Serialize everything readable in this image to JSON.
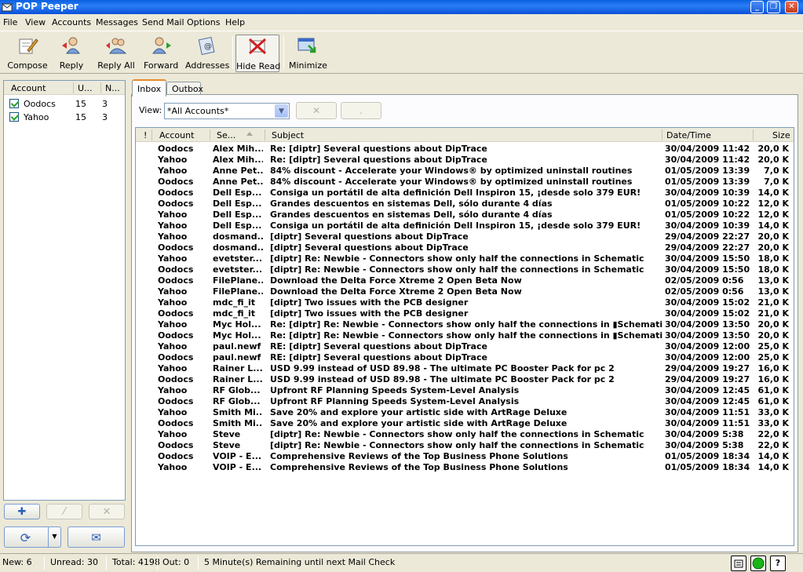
{
  "window": {
    "title": "POP Peeper"
  },
  "menu": [
    "File",
    "View",
    "Accounts",
    "Messages",
    "Send Mail",
    "Options",
    "Help"
  ],
  "toolbar": {
    "compose": "Compose",
    "reply": "Reply",
    "reply_all": "Reply All",
    "forward": "Forward",
    "addresses": "Addresses",
    "hide_read": "Hide Read",
    "minimize": "Minimize"
  },
  "accounts_panel": {
    "headers": {
      "account": "Account",
      "unread": "U...",
      "new": "N..."
    },
    "rows": [
      {
        "name": "Oodocs",
        "unread": "15",
        "new": "3"
      },
      {
        "name": "Yahoo",
        "unread": "15",
        "new": "3"
      }
    ]
  },
  "tabs": {
    "inbox": "Inbox",
    "outbox": "Outbox"
  },
  "view": {
    "label": "View:",
    "selected": "*All Accounts*"
  },
  "message_list": {
    "headers": {
      "flag": "!",
      "account": "Account",
      "sender": "Se...",
      "subject": "Subject",
      "date": "Date/Time",
      "size": "Size"
    },
    "rows": [
      {
        "account": "Oodocs",
        "sender": "Alex Mih...",
        "subject": "Re: [diptr] Several questions about DipTrace",
        "date": "30/04/2009 11:42",
        "size": "20,0 K"
      },
      {
        "account": "Yahoo",
        "sender": "Alex Mih...",
        "subject": "Re: [diptr] Several questions about DipTrace",
        "date": "30/04/2009 11:42",
        "size": "20,0 K"
      },
      {
        "account": "Yahoo",
        "sender": "Anne Pet...",
        "subject": "84% discount - Accelerate your Windows® by optimized uninstall routines",
        "date": "01/05/2009 13:39",
        "size": "7,0 K"
      },
      {
        "account": "Oodocs",
        "sender": "Anne Pet...",
        "subject": "84% discount - Accelerate your Windows® by optimized uninstall routines",
        "date": "01/05/2009 13:39",
        "size": "7,0 K"
      },
      {
        "account": "Oodocs",
        "sender": "Dell Esp...",
        "subject": "Consiga un portátil de alta definición Dell Inspiron 15, ¡desde solo 379 EUR!",
        "date": "30/04/2009 10:39",
        "size": "14,0 K"
      },
      {
        "account": "Oodocs",
        "sender": "Dell Esp...",
        "subject": "Grandes descuentos en sistemas Dell, sólo durante 4 días",
        "date": "01/05/2009 10:22",
        "size": "12,0 K"
      },
      {
        "account": "Yahoo",
        "sender": "Dell Esp...",
        "subject": "Grandes descuentos en sistemas Dell, sólo durante 4 días",
        "date": "01/05/2009 10:22",
        "size": "12,0 K"
      },
      {
        "account": "Yahoo",
        "sender": "Dell Esp...",
        "subject": "Consiga un portátil de alta definición Dell Inspiron 15, ¡desde solo 379 EUR!",
        "date": "30/04/2009 10:39",
        "size": "14,0 K"
      },
      {
        "account": "Yahoo",
        "sender": "dosmand...",
        "subject": "[diptr] Several questions about DipTrace",
        "date": "29/04/2009 22:27",
        "size": "20,0 K"
      },
      {
        "account": "Oodocs",
        "sender": "dosmand...",
        "subject": "[diptr] Several questions about DipTrace",
        "date": "29/04/2009 22:27",
        "size": "20,0 K"
      },
      {
        "account": "Yahoo",
        "sender": "evetster...",
        "subject": "[diptr] Re: Newbie - Connectors show only half the connections in Schematic",
        "date": "30/04/2009 15:50",
        "size": "18,0 K"
      },
      {
        "account": "Oodocs",
        "sender": "evetster...",
        "subject": "[diptr] Re: Newbie - Connectors show only half the connections in Schematic",
        "date": "30/04/2009 15:50",
        "size": "18,0 K"
      },
      {
        "account": "Oodocs",
        "sender": "FilePlane...",
        "subject": "Download the Delta Force Xtreme 2 Open Beta Now",
        "date": "02/05/2009 0:56",
        "size": "13,0 K"
      },
      {
        "account": "Yahoo",
        "sender": "FilePlane...",
        "subject": "Download the Delta Force Xtreme 2 Open Beta Now",
        "date": "02/05/2009 0:56",
        "size": "13,0 K"
      },
      {
        "account": "Yahoo",
        "sender": "mdc_fi_it",
        "subject": "[diptr] Two issues with the PCB designer",
        "date": "30/04/2009 15:02",
        "size": "21,0 K"
      },
      {
        "account": "Oodocs",
        "sender": "mdc_fi_it",
        "subject": "[diptr] Two issues with the PCB designer",
        "date": "30/04/2009 15:02",
        "size": "21,0 K"
      },
      {
        "account": "Yahoo",
        "sender": "Myc Hol...",
        "subject": "Re: [diptr] Re: Newbie - Connectors show only half the connections in ▮Schematic",
        "date": "30/04/2009 13:50",
        "size": "20,0 K"
      },
      {
        "account": "Oodocs",
        "sender": "Myc Hol...",
        "subject": "Re: [diptr] Re: Newbie - Connectors show only half the connections in ▮Schematic",
        "date": "30/04/2009 13:50",
        "size": "20,0 K"
      },
      {
        "account": "Yahoo",
        "sender": "paul.newf",
        "subject": "RE: [diptr] Several questions about DipTrace",
        "date": "30/04/2009 12:00",
        "size": "25,0 K"
      },
      {
        "account": "Oodocs",
        "sender": "paul.newf",
        "subject": "RE: [diptr] Several questions about DipTrace",
        "date": "30/04/2009 12:00",
        "size": "25,0 K"
      },
      {
        "account": "Yahoo",
        "sender": "Rainer L...",
        "subject": "USD 9.99 instead of USD 89.98 - The ultimate PC Booster Pack for pc 2",
        "date": "29/04/2009 19:27",
        "size": "16,0 K"
      },
      {
        "account": "Oodocs",
        "sender": "Rainer L...",
        "subject": "USD 9.99 instead of USD 89.98 - The ultimate PC Booster Pack for pc 2",
        "date": "29/04/2009 19:27",
        "size": "16,0 K"
      },
      {
        "account": "Yahoo",
        "sender": "RF Glob...",
        "subject": "Upfront RF Planning Speeds System-Level Analysis",
        "date": "30/04/2009 12:45",
        "size": "61,0 K"
      },
      {
        "account": "Oodocs",
        "sender": "RF Glob...",
        "subject": "Upfront RF Planning Speeds System-Level Analysis",
        "date": "30/04/2009 12:45",
        "size": "61,0 K"
      },
      {
        "account": "Yahoo",
        "sender": "Smith Mi...",
        "subject": "Save 20% and explore your artistic side with ArtRage Deluxe",
        "date": "30/04/2009 11:51",
        "size": "33,0 K"
      },
      {
        "account": "Oodocs",
        "sender": "Smith Mi...",
        "subject": "Save 20% and explore your artistic side with ArtRage Deluxe",
        "date": "30/04/2009 11:51",
        "size": "33,0 K"
      },
      {
        "account": "Yahoo",
        "sender": "Steve",
        "subject": "[diptr] Re: Newbie - Connectors show only half the connections in Schematic",
        "date": "30/04/2009 5:38",
        "size": "22,0 K"
      },
      {
        "account": "Oodocs",
        "sender": "Steve",
        "subject": "[diptr] Re: Newbie - Connectors show only half the connections in Schematic",
        "date": "30/04/2009 5:38",
        "size": "22,0 K"
      },
      {
        "account": "Oodocs",
        "sender": "VOIP - E...",
        "subject": "Comprehensive Reviews of the Top Business Phone Solutions",
        "date": "01/05/2009 18:34",
        "size": "14,0 K"
      },
      {
        "account": "Yahoo",
        "sender": "VOIP - E...",
        "subject": "Comprehensive Reviews of the Top Business Phone Solutions",
        "date": "01/05/2009 18:34",
        "size": "14,0 K"
      }
    ]
  },
  "statusbar": {
    "new": "New: 6",
    "unread": "Unread: 30",
    "total": "Total: 4198",
    "out": "Out: 0",
    "check": "5 Minute(s) Remaining until next Mail Check",
    "help": "?"
  }
}
